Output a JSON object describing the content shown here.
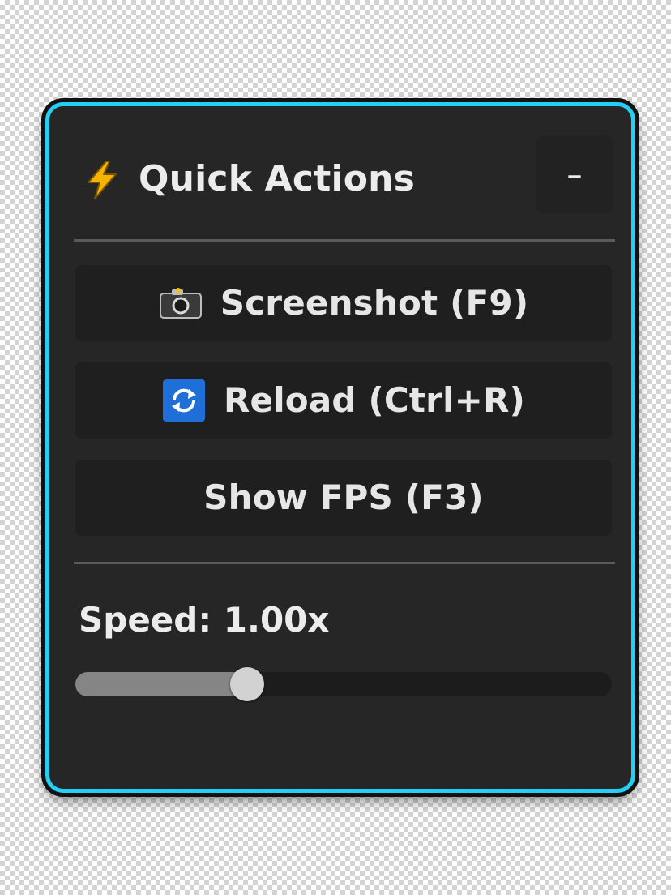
{
  "panel": {
    "accent_color": "#22d0f5",
    "header": {
      "icon": "lightning-bolt-icon",
      "title": "Quick Actions",
      "minimize_label": "–"
    },
    "actions": [
      {
        "icon": "camera-icon",
        "label": "Screenshot (F9)"
      },
      {
        "icon": "reload-icon",
        "label": "Reload (Ctrl+R)"
      },
      {
        "icon": "",
        "label": "Show FPS (F3)"
      }
    ],
    "speed": {
      "label": "Speed: 1.00x",
      "value": 1.0,
      "slider_fraction": 0.32
    }
  }
}
